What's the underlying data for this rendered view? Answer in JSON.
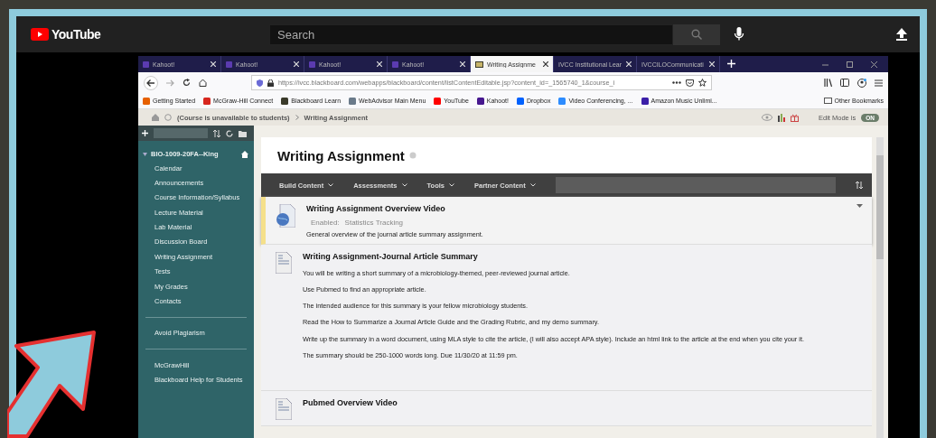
{
  "youtube": {
    "logo": "YouTube",
    "search": {
      "placeholder": "Search"
    }
  },
  "browser": {
    "tabs": [
      {
        "label": "Kahoot!",
        "kind": "kahoot",
        "selected": false
      },
      {
        "label": "Kahoot!",
        "kind": "kahoot",
        "selected": false
      },
      {
        "label": "Kahoot!",
        "kind": "kahoot",
        "selected": false
      },
      {
        "label": "Kahoot!",
        "kind": "kahoot",
        "selected": false
      },
      {
        "label": "Writing Assignme",
        "kind": "blackboard",
        "selected": true
      },
      {
        "label": "IVCC Institutional Lear",
        "kind": "plain",
        "selected": false
      },
      {
        "label": "IVCCILOCommunicati",
        "kind": "plain",
        "selected": false
      }
    ],
    "url": "https://ivcc.blackboard.com/webapps/blackboard/content/listContentEditable.jsp?content_id=_1565740_1&course_i",
    "bookmarks": [
      {
        "label": "Getting Started",
        "color": "#e66000"
      },
      {
        "label": "McGraw-Hill Connect",
        "color": "#d7261e"
      },
      {
        "label": "Blackboard Learn",
        "color": "#3a3a2a"
      },
      {
        "label": "WebAdvisor Main Menu",
        "color": "#6a7a8a"
      },
      {
        "label": "YouTube",
        "color": "#ff0000"
      },
      {
        "label": "Kahoot!",
        "color": "#46178f"
      },
      {
        "label": "Dropbox",
        "color": "#0061fe"
      },
      {
        "label": "Video Conferencing, ...",
        "color": "#2d8cff"
      },
      {
        "label": "Amazon Music Unlimi...",
        "color": "#3b1fa8"
      }
    ],
    "other_bookmarks": "Other Bookmarks"
  },
  "breadcrumb": [
    "(Course is unavailable to students)",
    "Writing Assignment"
  ],
  "edit_mode": {
    "label": "Edit Mode is",
    "toggle": "ON",
    "on": true
  },
  "sidebar": {
    "course": "BIO-1009-20FA--King",
    "groups": [
      [
        "Calendar",
        "Announcements",
        "Course Information/Syllabus",
        "Lecture Material",
        "Lab Material",
        "Discussion Board",
        "Writing Assignment",
        "Tests",
        "My Grades",
        "Contacts"
      ],
      [
        "Avoid Plagiarism"
      ],
      [
        "McGrawHill",
        "Blackboard Help for Students"
      ]
    ]
  },
  "content": {
    "title": "Writing Assignment",
    "menus": [
      "Build Content",
      "Assessments",
      "Tools",
      "Partner Content"
    ],
    "items": [
      {
        "kind": "video",
        "highlighted": true,
        "title": "Writing Assignment Overview Video",
        "details": [
          "Enabled:",
          "Statistics Tracking"
        ],
        "paragraphs": [
          "General overview of the journal article summary assignment."
        ]
      },
      {
        "kind": "document",
        "highlighted": false,
        "title": "Writing Assignment-Journal Article Summary",
        "paragraphs": [
          "You will be writing a short summary of a microbiology-themed, peer-reviewed journal article.",
          "Use Pubmed to find an appropriate article.",
          "The intended audience for this summary is your fellow microbiology students.",
          "Read the How to Summarize a Journal Article Guide and the Grading Rubric, and my demo summary.",
          "Write up the summary in a word document, using MLA style to cite the article, (I will also accept APA style). Include an html link to the article at the end when you cite your it.",
          "The summary should be 250-1000 words long. Due 11/30/20 at 11:59 pm."
        ]
      },
      {
        "kind": "document",
        "highlighted": false,
        "title": "Pubmed Overview Video"
      }
    ]
  }
}
